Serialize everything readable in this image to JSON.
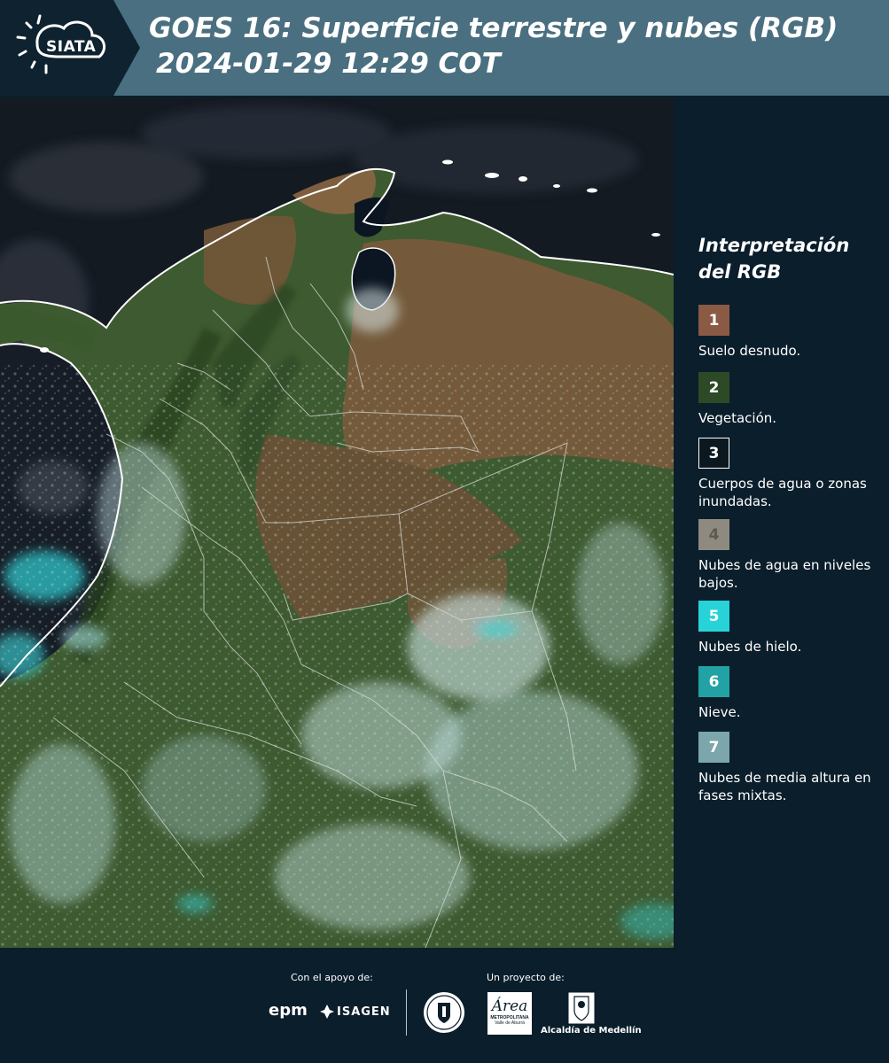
{
  "header": {
    "logo_text": "SIATA",
    "title_line1": "GOES 16: Superficie terrestre y nubes (RGB)",
    "title_line2": "2024-01-29 12:29 COT"
  },
  "map": {
    "type": "satellite RGB composite"
  },
  "legend": {
    "title_line1": "Interpretación",
    "title_line2": "del RGB",
    "items": [
      {
        "number": "1",
        "label": "Suelo desnudo.",
        "color": "#8a5a45"
      },
      {
        "number": "2",
        "label": "Vegetación.",
        "color": "#2d4a26"
      },
      {
        "number": "3",
        "label": "Cuerpos de agua o zonas inundadas.",
        "color": "#0c1820"
      },
      {
        "number": "4",
        "label": "Nubes de agua en niveles bajos.",
        "color": "#8e8a80"
      },
      {
        "number": "5",
        "label": "Nubes de hielo.",
        "color": "#27d3d8"
      },
      {
        "number": "6",
        "label": "Nieve.",
        "color": "#22a2a4"
      },
      {
        "number": "7",
        "label": "Nubes de media altura en fases mixtas.",
        "color": "#7ba6ab"
      }
    ]
  },
  "footer": {
    "support_label": "Con el apoyo de:",
    "project_label": "Un proyecto de:",
    "sponsor1": "epm",
    "sponsor2": "ISAGEN",
    "area_text": "Área",
    "area_sub": "METROPOLITANA",
    "area_sub2": "Valle de Aburrá",
    "alcaldia": "Alcaldía de Medellín"
  }
}
